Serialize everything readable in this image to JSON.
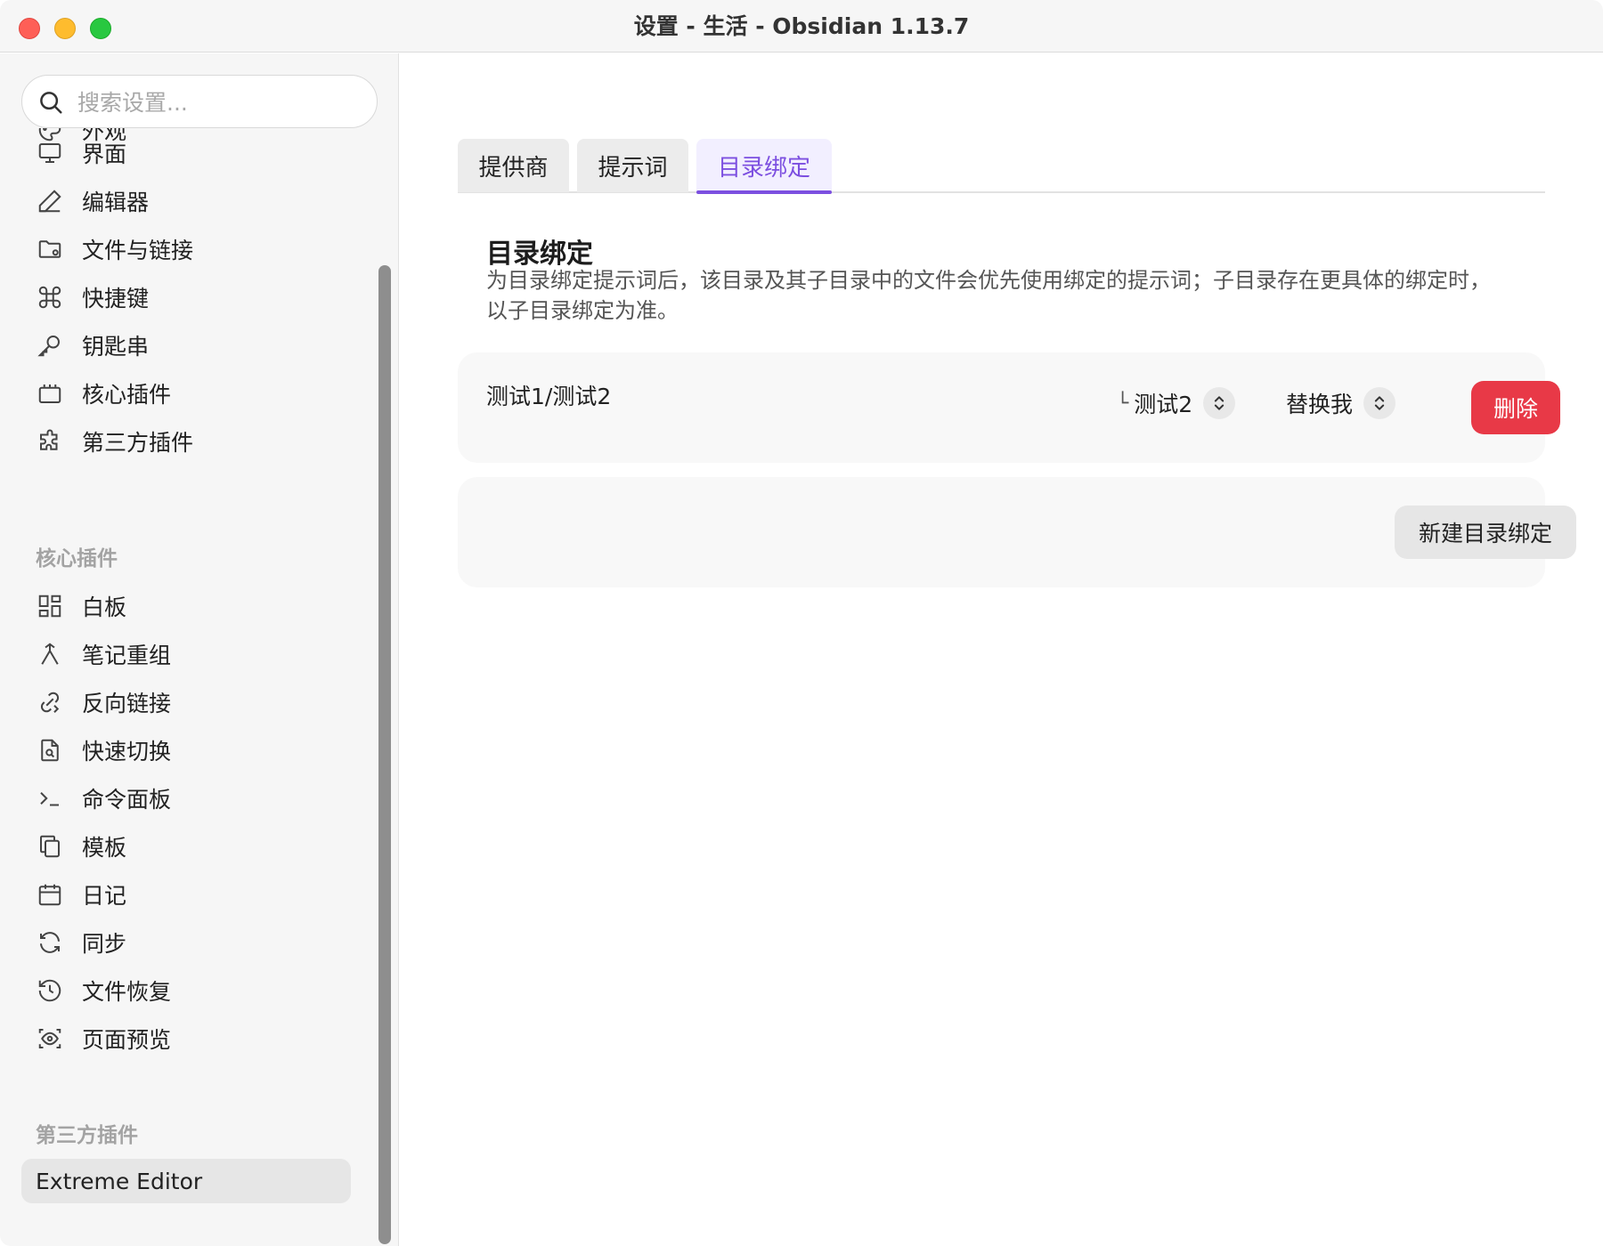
{
  "window": {
    "title": "设置 - 生活 - Obsidian 1.13.7"
  },
  "search": {
    "placeholder": "搜索设置..."
  },
  "sidebar": {
    "options": [
      {
        "label": "外观",
        "icon": "palette-icon"
      },
      {
        "label": "界面",
        "icon": "monitor-icon"
      },
      {
        "label": "编辑器",
        "icon": "pencil-icon"
      },
      {
        "label": "文件与链接",
        "icon": "folder-cog-icon"
      },
      {
        "label": "快捷键",
        "icon": "command-icon"
      },
      {
        "label": "钥匙串",
        "icon": "key-icon"
      },
      {
        "label": "核心插件",
        "icon": "plug-icon"
      },
      {
        "label": "第三方插件",
        "icon": "puzzle-icon"
      }
    ],
    "core_heading": "核心插件",
    "core_plugins": [
      {
        "label": "白板",
        "icon": "layout-dashboard-icon"
      },
      {
        "label": "笔记重组",
        "icon": "merge-icon"
      },
      {
        "label": "反向链接",
        "icon": "backlink-icon"
      },
      {
        "label": "快速切换",
        "icon": "file-search-icon"
      },
      {
        "label": "命令面板",
        "icon": "terminal-icon"
      },
      {
        "label": "模板",
        "icon": "copy-icon"
      },
      {
        "label": "日记",
        "icon": "calendar-icon"
      },
      {
        "label": "同步",
        "icon": "refresh-icon"
      },
      {
        "label": "文件恢复",
        "icon": "history-icon"
      },
      {
        "label": "页面预览",
        "icon": "scan-eye-icon"
      }
    ],
    "community_heading": "第三方插件",
    "community_plugins": [
      {
        "label": "Extreme Editor"
      }
    ]
  },
  "tabs": [
    {
      "label": "提供商",
      "active": false
    },
    {
      "label": "提示词",
      "active": false
    },
    {
      "label": "目录绑定",
      "active": true
    }
  ],
  "section": {
    "title": "目录绑定",
    "description": "为目录绑定提示词后，该目录及其子目录中的文件会优先使用绑定的提示词；子目录存在更具体的绑定时，以子目录绑定为准。"
  },
  "binding": {
    "path": "测试1/测试2",
    "directory_branch": "└",
    "directory_value": "测试2",
    "prompt_value": "替换我",
    "delete_label": "删除"
  },
  "actions": {
    "new_binding_label": "新建目录绑定"
  },
  "colors": {
    "accent": "#7c4fe0",
    "danger": "#e83947"
  }
}
